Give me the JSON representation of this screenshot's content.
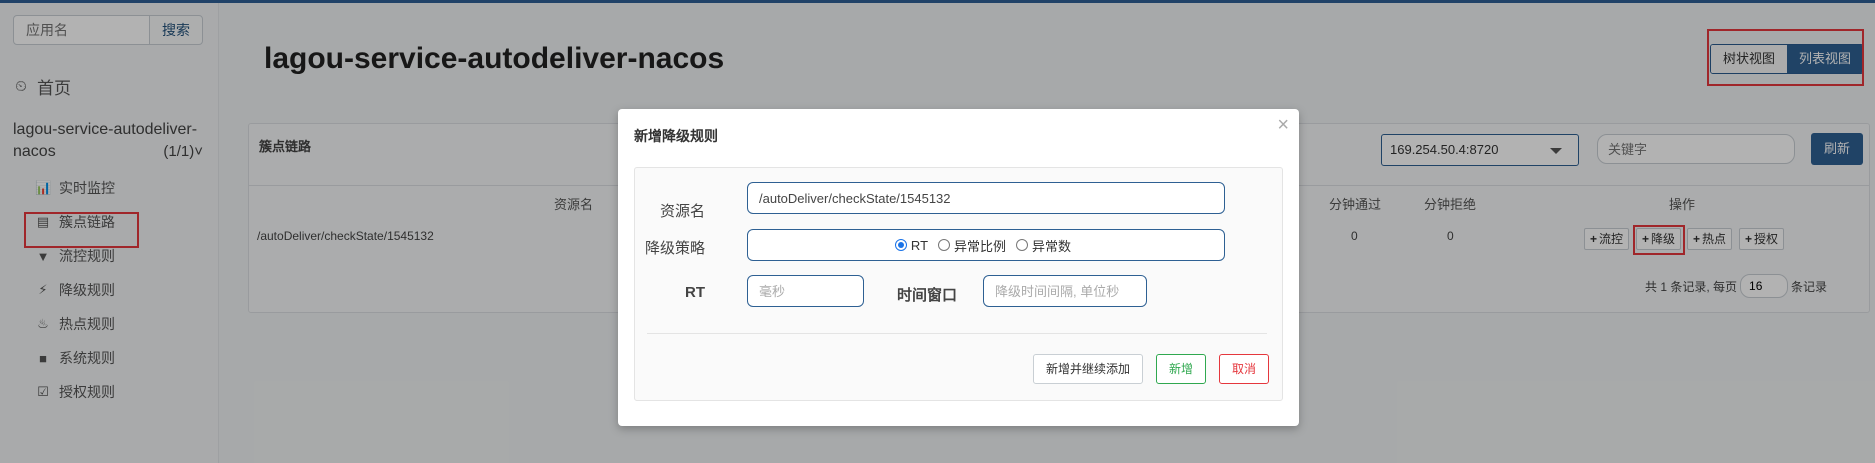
{
  "sidebar": {
    "search": {
      "placeholder": "应用名",
      "button": "搜索"
    },
    "home": {
      "label": "首页",
      "icon": "dashboard-icon"
    },
    "app": {
      "name": "lagou-service-autodeliver-nacos",
      "count": "(1/1)"
    },
    "items": [
      {
        "label": "实时监控",
        "icon": "bar-chart-icon"
      },
      {
        "label": "簇点链路",
        "icon": "list-icon",
        "active": true
      },
      {
        "label": "流控规则",
        "icon": "filter-icon"
      },
      {
        "label": "降级规则",
        "icon": "flash-icon"
      },
      {
        "label": "热点规则",
        "icon": "fire-icon"
      },
      {
        "label": "系统规则",
        "icon": "lock-icon"
      },
      {
        "label": "授权规则",
        "icon": "check-icon"
      }
    ]
  },
  "header": {
    "title": "lagou-service-autodeliver-nacos",
    "view_tree": "树状视图",
    "view_list": "列表视图"
  },
  "panel": {
    "title": "簇点链路",
    "machine": "169.254.50.4:8720",
    "keyword_placeholder": "关键字",
    "refresh": "刷新",
    "columns": {
      "resource": "资源名",
      "pass_per_min": "分钟通过",
      "block_per_min": "分钟拒绝",
      "ops": "操作"
    },
    "rows": [
      {
        "resource": "/autoDeliver/checkState/1545132",
        "pass_per_min": "0",
        "block_per_min": "0"
      }
    ],
    "ops": {
      "flow": "流控",
      "degrade": "降级",
      "hot": "热点",
      "auth": "授权"
    },
    "pager": {
      "prefix": "共 1 条记录, 每页",
      "page_size": "16",
      "suffix": "条记录"
    }
  },
  "modal": {
    "title": "新增降级规则",
    "close": "×",
    "resource_label": "资源名",
    "resource_value": "/autoDeliver/checkState/1545132",
    "strategy_label": "降级策略",
    "strategies": [
      "RT",
      "异常比例",
      "异常数"
    ],
    "selected_strategy": "RT",
    "rt_label": "RT",
    "rt_placeholder": "毫秒",
    "window_label": "时间窗口",
    "window_placeholder": "降级时间间隔, 单位秒",
    "btn_add_continue": "新增并继续添加",
    "btn_add": "新增",
    "btn_cancel": "取消"
  },
  "colors": {
    "primary": "#2e6093",
    "highlight": "#e5373d",
    "success": "#2fa84f"
  }
}
